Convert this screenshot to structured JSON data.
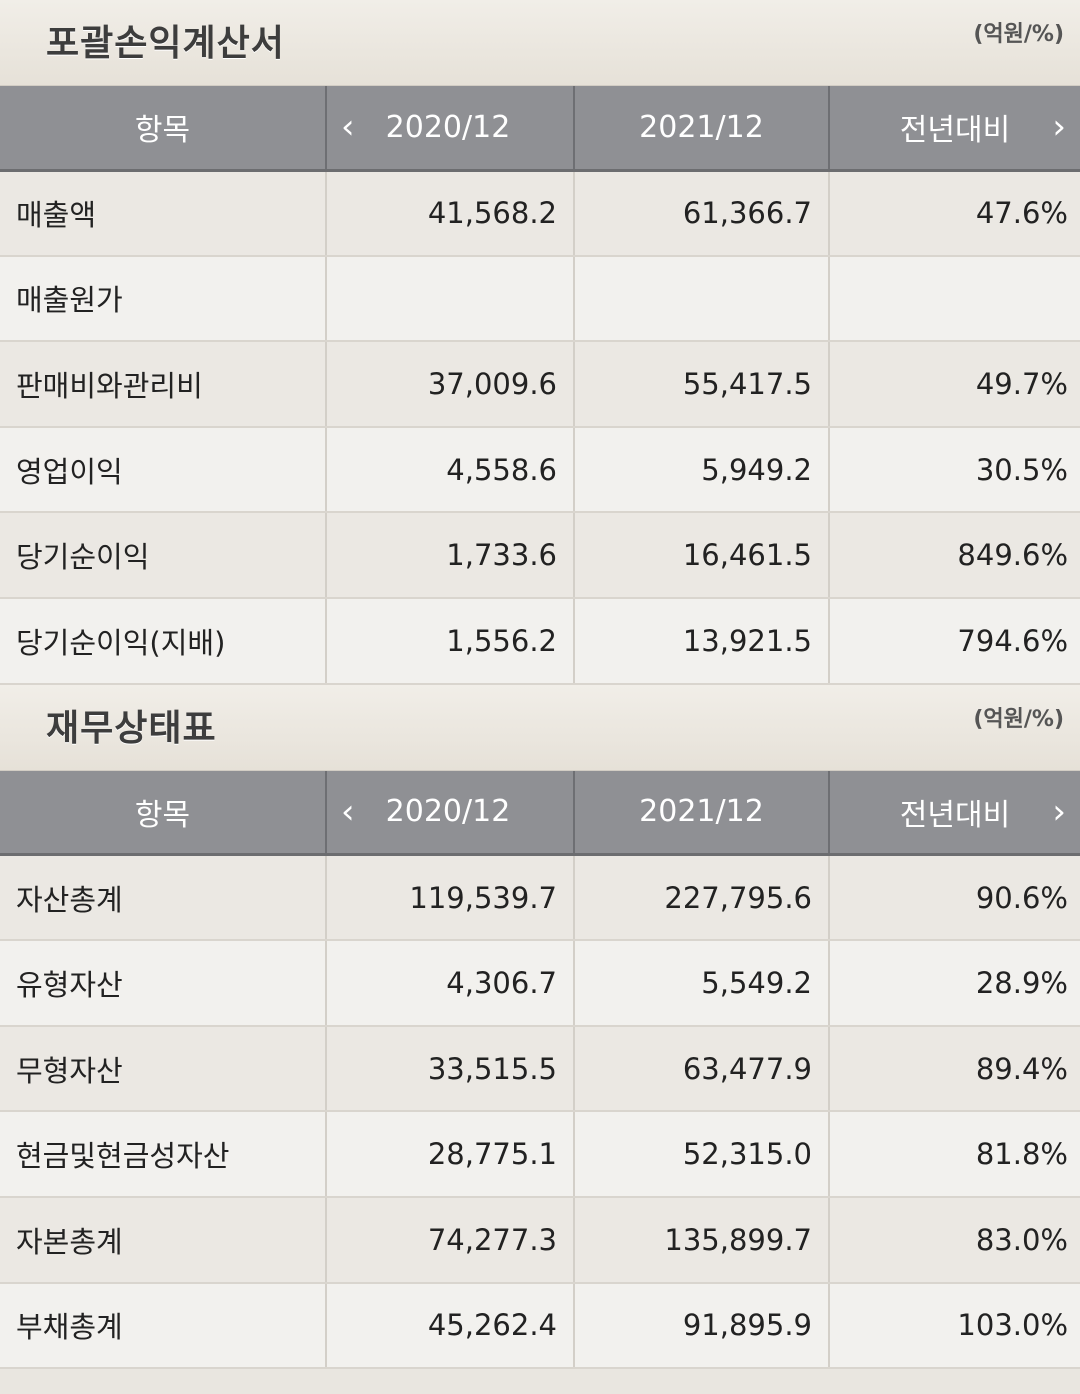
{
  "income": {
    "title": "포괄손익계산서",
    "unit": "(억원/%)",
    "headers": [
      "항목",
      "2020/12",
      "2021/12",
      "전년대비"
    ],
    "rows": [
      {
        "label": "매출액",
        "v2020": "41,568.2",
        "v2021": "61,366.7",
        "yoy": "47.6%"
      },
      {
        "label": "매출원가",
        "v2020": "",
        "v2021": "",
        "yoy": ""
      },
      {
        "label": "판매비와관리비",
        "v2020": "37,009.6",
        "v2021": "55,417.5",
        "yoy": "49.7%"
      },
      {
        "label": "영업이익",
        "v2020": "4,558.6",
        "v2021": "5,949.2",
        "yoy": "30.5%"
      },
      {
        "label": "당기순이익",
        "v2020": "1,733.6",
        "v2021": "16,461.5",
        "yoy": "849.6%"
      },
      {
        "label": "당기순이익(지배)",
        "v2020": "1,556.2",
        "v2021": "13,921.5",
        "yoy": "794.6%"
      }
    ]
  },
  "balance": {
    "title": "재무상태표",
    "unit": "(억원/%)",
    "headers": [
      "항목",
      "2020/12",
      "2021/12",
      "전년대비"
    ],
    "rows": [
      {
        "label": "자산총계",
        "v2020": "119,539.7",
        "v2021": "227,795.6",
        "yoy": "90.6%"
      },
      {
        "label": "유형자산",
        "v2020": "4,306.7",
        "v2021": "5,549.2",
        "yoy": "28.9%"
      },
      {
        "label": "무형자산",
        "v2020": "33,515.5",
        "v2021": "63,477.9",
        "yoy": "89.4%"
      },
      {
        "label": "현금및현금성자산",
        "v2020": "28,775.1",
        "v2021": "52,315.0",
        "yoy": "81.8%"
      },
      {
        "label": "자본총계",
        "v2020": "74,277.3",
        "v2021": "135,899.7",
        "yoy": "83.0%"
      },
      {
        "label": "부채총계",
        "v2020": "45,262.4",
        "v2021": "91,895.9",
        "yoy": "103.0%"
      }
    ]
  },
  "icons": {
    "prev": "chevron-left-icon",
    "next": "chevron-right-icon"
  }
}
